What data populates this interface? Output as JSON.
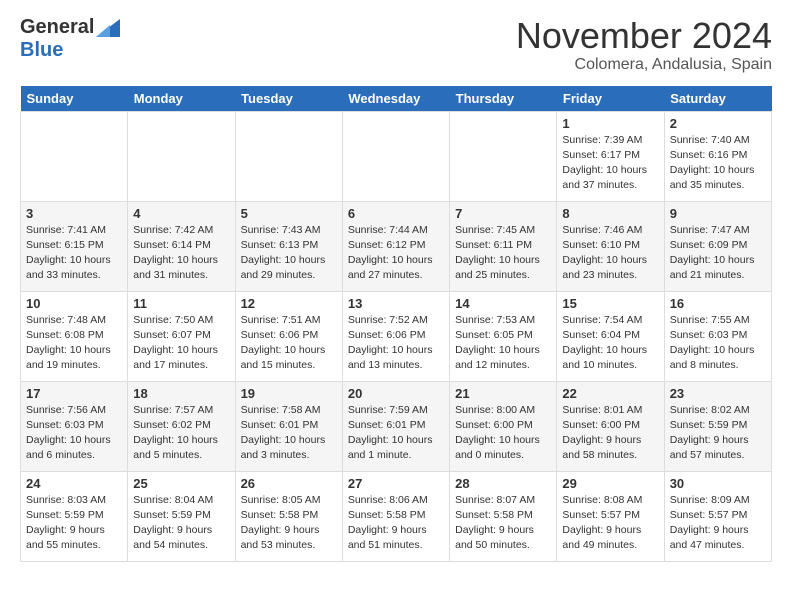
{
  "header": {
    "logo_general": "General",
    "logo_blue": "Blue",
    "month_title": "November 2024",
    "location": "Colomera, Andalusia, Spain"
  },
  "days_of_week": [
    "Sunday",
    "Monday",
    "Tuesday",
    "Wednesday",
    "Thursday",
    "Friday",
    "Saturday"
  ],
  "weeks": [
    [
      {
        "day": "",
        "info": ""
      },
      {
        "day": "",
        "info": ""
      },
      {
        "day": "",
        "info": ""
      },
      {
        "day": "",
        "info": ""
      },
      {
        "day": "",
        "info": ""
      },
      {
        "day": "1",
        "info": "Sunrise: 7:39 AM\nSunset: 6:17 PM\nDaylight: 10 hours and 37 minutes."
      },
      {
        "day": "2",
        "info": "Sunrise: 7:40 AM\nSunset: 6:16 PM\nDaylight: 10 hours and 35 minutes."
      }
    ],
    [
      {
        "day": "3",
        "info": "Sunrise: 7:41 AM\nSunset: 6:15 PM\nDaylight: 10 hours and 33 minutes."
      },
      {
        "day": "4",
        "info": "Sunrise: 7:42 AM\nSunset: 6:14 PM\nDaylight: 10 hours and 31 minutes."
      },
      {
        "day": "5",
        "info": "Sunrise: 7:43 AM\nSunset: 6:13 PM\nDaylight: 10 hours and 29 minutes."
      },
      {
        "day": "6",
        "info": "Sunrise: 7:44 AM\nSunset: 6:12 PM\nDaylight: 10 hours and 27 minutes."
      },
      {
        "day": "7",
        "info": "Sunrise: 7:45 AM\nSunset: 6:11 PM\nDaylight: 10 hours and 25 minutes."
      },
      {
        "day": "8",
        "info": "Sunrise: 7:46 AM\nSunset: 6:10 PM\nDaylight: 10 hours and 23 minutes."
      },
      {
        "day": "9",
        "info": "Sunrise: 7:47 AM\nSunset: 6:09 PM\nDaylight: 10 hours and 21 minutes."
      }
    ],
    [
      {
        "day": "10",
        "info": "Sunrise: 7:48 AM\nSunset: 6:08 PM\nDaylight: 10 hours and 19 minutes."
      },
      {
        "day": "11",
        "info": "Sunrise: 7:50 AM\nSunset: 6:07 PM\nDaylight: 10 hours and 17 minutes."
      },
      {
        "day": "12",
        "info": "Sunrise: 7:51 AM\nSunset: 6:06 PM\nDaylight: 10 hours and 15 minutes."
      },
      {
        "day": "13",
        "info": "Sunrise: 7:52 AM\nSunset: 6:06 PM\nDaylight: 10 hours and 13 minutes."
      },
      {
        "day": "14",
        "info": "Sunrise: 7:53 AM\nSunset: 6:05 PM\nDaylight: 10 hours and 12 minutes."
      },
      {
        "day": "15",
        "info": "Sunrise: 7:54 AM\nSunset: 6:04 PM\nDaylight: 10 hours and 10 minutes."
      },
      {
        "day": "16",
        "info": "Sunrise: 7:55 AM\nSunset: 6:03 PM\nDaylight: 10 hours and 8 minutes."
      }
    ],
    [
      {
        "day": "17",
        "info": "Sunrise: 7:56 AM\nSunset: 6:03 PM\nDaylight: 10 hours and 6 minutes."
      },
      {
        "day": "18",
        "info": "Sunrise: 7:57 AM\nSunset: 6:02 PM\nDaylight: 10 hours and 5 minutes."
      },
      {
        "day": "19",
        "info": "Sunrise: 7:58 AM\nSunset: 6:01 PM\nDaylight: 10 hours and 3 minutes."
      },
      {
        "day": "20",
        "info": "Sunrise: 7:59 AM\nSunset: 6:01 PM\nDaylight: 10 hours and 1 minute."
      },
      {
        "day": "21",
        "info": "Sunrise: 8:00 AM\nSunset: 6:00 PM\nDaylight: 10 hours and 0 minutes."
      },
      {
        "day": "22",
        "info": "Sunrise: 8:01 AM\nSunset: 6:00 PM\nDaylight: 9 hours and 58 minutes."
      },
      {
        "day": "23",
        "info": "Sunrise: 8:02 AM\nSunset: 5:59 PM\nDaylight: 9 hours and 57 minutes."
      }
    ],
    [
      {
        "day": "24",
        "info": "Sunrise: 8:03 AM\nSunset: 5:59 PM\nDaylight: 9 hours and 55 minutes."
      },
      {
        "day": "25",
        "info": "Sunrise: 8:04 AM\nSunset: 5:59 PM\nDaylight: 9 hours and 54 minutes."
      },
      {
        "day": "26",
        "info": "Sunrise: 8:05 AM\nSunset: 5:58 PM\nDaylight: 9 hours and 53 minutes."
      },
      {
        "day": "27",
        "info": "Sunrise: 8:06 AM\nSunset: 5:58 PM\nDaylight: 9 hours and 51 minutes."
      },
      {
        "day": "28",
        "info": "Sunrise: 8:07 AM\nSunset: 5:58 PM\nDaylight: 9 hours and 50 minutes."
      },
      {
        "day": "29",
        "info": "Sunrise: 8:08 AM\nSunset: 5:57 PM\nDaylight: 9 hours and 49 minutes."
      },
      {
        "day": "30",
        "info": "Sunrise: 8:09 AM\nSunset: 5:57 PM\nDaylight: 9 hours and 47 minutes."
      }
    ]
  ]
}
